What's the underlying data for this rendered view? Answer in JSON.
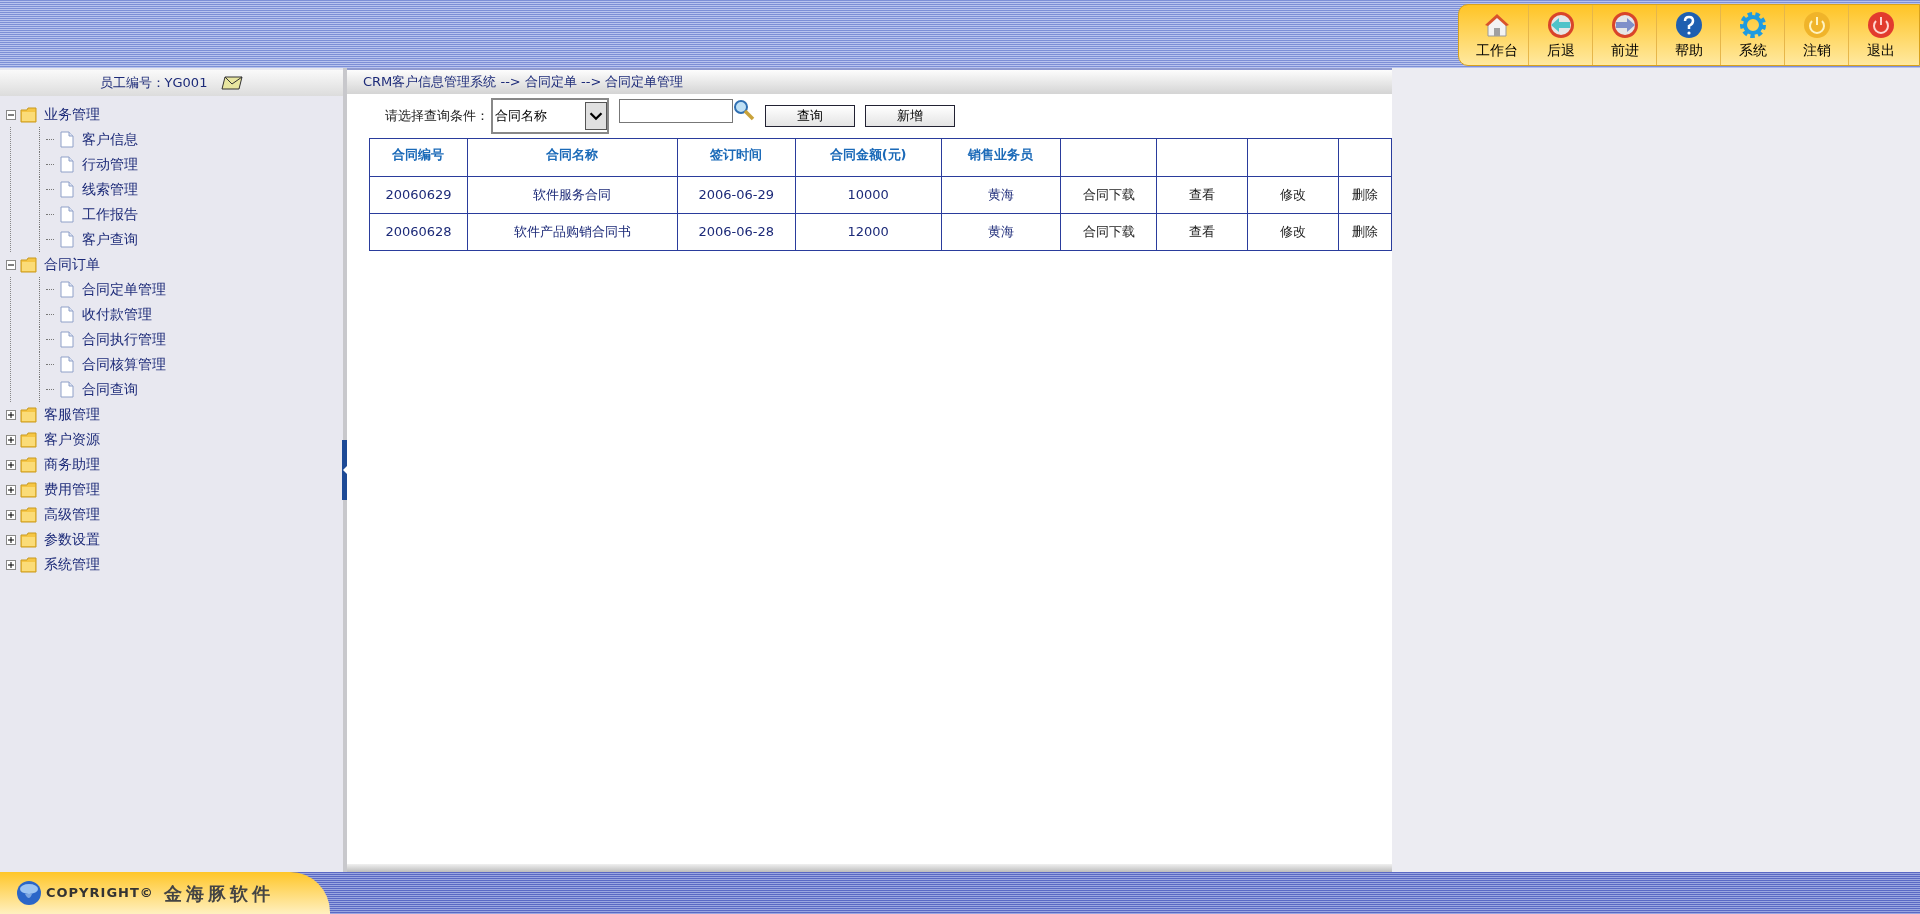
{
  "toolbar": [
    {
      "kind": "home",
      "label": "工作台"
    },
    {
      "kind": "back",
      "label": "后退"
    },
    {
      "kind": "forward",
      "label": "前进"
    },
    {
      "kind": "help",
      "label": "帮助"
    },
    {
      "kind": "system",
      "label": "系统"
    },
    {
      "kind": "logout",
      "label": "注销"
    },
    {
      "kind": "exit",
      "label": "退出"
    }
  ],
  "sidebar": {
    "employee": "员工编号：YG001",
    "tree": [
      {
        "label": "业务管理",
        "expanded": true,
        "children": [
          {
            "label": "客户信息"
          },
          {
            "label": "行动管理"
          },
          {
            "label": "线索管理"
          },
          {
            "label": "工作报告"
          },
          {
            "label": "客户查询"
          }
        ]
      },
      {
        "label": "合同订单",
        "expanded": true,
        "children": [
          {
            "label": "合同定单管理"
          },
          {
            "label": "收付款管理"
          },
          {
            "label": "合同执行管理"
          },
          {
            "label": "合同核算管理"
          },
          {
            "label": "合同查询"
          }
        ]
      },
      {
        "label": "客服管理",
        "expanded": false
      },
      {
        "label": "客户资源",
        "expanded": false
      },
      {
        "label": "商务助理",
        "expanded": false
      },
      {
        "label": "费用管理",
        "expanded": false
      },
      {
        "label": "高级管理",
        "expanded": false
      },
      {
        "label": "参数设置",
        "expanded": false
      },
      {
        "label": "系统管理",
        "expanded": false
      }
    ]
  },
  "breadcrumb": "CRM客户信息管理系统 --> 合同定单 --> 合同定单管理",
  "search": {
    "label": "请选择查询条件：",
    "select_value": "合同名称",
    "buttons": [
      "查询",
      "新增"
    ]
  },
  "table": {
    "columns": [
      "合同编号",
      "合同名称",
      "签订时间",
      "合同金额(元)",
      "销售业务员"
    ],
    "rows": [
      [
        "20060629",
        "软件服务合同",
        "2006-06-29",
        "10000",
        "黄海",
        "合同下载",
        "查看",
        "修改",
        "删除"
      ],
      [
        "20060628",
        "软件产品购销合同书",
        "2006-06-28",
        "12000",
        "黄海",
        "合同下载",
        "查看",
        "修改",
        "删除"
      ]
    ]
  },
  "footer": {
    "copyright": "COPYRIGHT©",
    "company": "金海豚软件"
  }
}
